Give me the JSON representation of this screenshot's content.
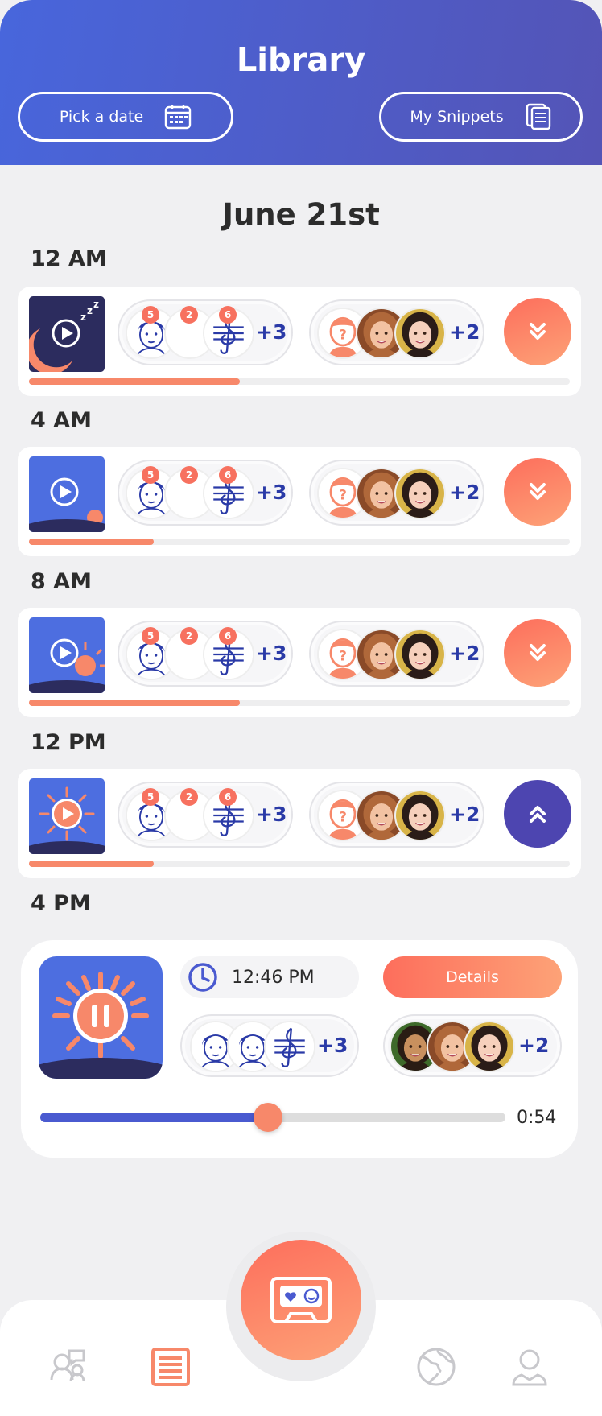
{
  "header": {
    "title": "Library",
    "pick_date_label": "Pick a date",
    "snippets_label": "My Snippets"
  },
  "date_heading": "June 21st",
  "entries": [
    {
      "time": "12 AM",
      "theme": "night",
      "badges": [
        "5",
        "2",
        "6"
      ],
      "more_left": "+3",
      "more_right": "+2",
      "progress": 0.39,
      "expanded": false
    },
    {
      "time": "4 AM",
      "theme": "dawn",
      "badges": [
        "5",
        "2",
        "6"
      ],
      "more_left": "+3",
      "more_right": "+2",
      "progress": 0.23,
      "expanded": false
    },
    {
      "time": "8 AM",
      "theme": "morning",
      "badges": [
        "5",
        "2",
        "6"
      ],
      "more_left": "+3",
      "more_right": "+2",
      "progress": 0.39,
      "expanded": false
    },
    {
      "time": "12 PM",
      "theme": "noon",
      "badges": [
        "5",
        "2",
        "6"
      ],
      "more_left": "+3",
      "more_right": "+2",
      "progress": 0.23,
      "expanded": true
    }
  ],
  "player": {
    "time_label": "4 PM",
    "timestamp": "12:46 PM",
    "details_label": "Details",
    "more_left": "+3",
    "more_right": "+2",
    "progress": 0.49,
    "duration": "0:54"
  },
  "colors": {
    "accent": "#f7886a",
    "brand": "#4a5ad0",
    "collapse": "#4d45b0"
  },
  "icons": [
    "calendar-icon",
    "snippets-icon",
    "chevron-down-icon",
    "chevron-up-icon",
    "clock-icon",
    "pause-icon",
    "cassette-icon",
    "people-chat-icon",
    "list-icon",
    "globe-icon",
    "profile-icon"
  ]
}
